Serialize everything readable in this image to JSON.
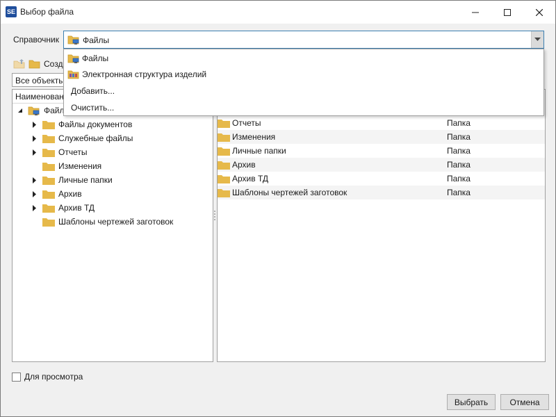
{
  "window": {
    "title": "Выбор файла",
    "app_icon_text": "SE"
  },
  "reference": {
    "label": "Справочник",
    "selected": "Файлы"
  },
  "toolbar": {
    "create_label": "Созда"
  },
  "filter": {
    "value": "Все объекты"
  },
  "tree": {
    "header": "Наименован",
    "root_label": "Файлы",
    "items": [
      {
        "label": "Файлы документов",
        "expandable": true
      },
      {
        "label": "Служебные файлы",
        "expandable": true
      },
      {
        "label": "Отчеты",
        "expandable": true
      },
      {
        "label": "Изменения",
        "expandable": false
      },
      {
        "label": "Личные папки",
        "expandable": true
      },
      {
        "label": "Архив",
        "expandable": true
      },
      {
        "label": "Архив ТД",
        "expandable": true
      },
      {
        "label": "Шаблоны чертежей заготовок",
        "expandable": false
      }
    ]
  },
  "list": {
    "rows": [
      {
        "name": "Отчеты",
        "type": "Папка"
      },
      {
        "name": "Изменения",
        "type": "Папка"
      },
      {
        "name": "Личные папки",
        "type": "Папка"
      },
      {
        "name": "Архив",
        "type": "Папка"
      },
      {
        "name": "Архив ТД",
        "type": "Папка"
      },
      {
        "name": "Шаблоны чертежей заготовок",
        "type": "Папка"
      }
    ]
  },
  "dropdown": {
    "items": [
      {
        "label": "Файлы",
        "icon": "folder-computer-icon"
      },
      {
        "label": "Электронная структура изделий",
        "icon": "product-structure-icon"
      },
      {
        "label": "Добавить...",
        "icon": ""
      },
      {
        "label": "Очистить...",
        "icon": ""
      }
    ]
  },
  "footer": {
    "preview_label": "Для просмотра",
    "preview_checked": false,
    "ok_label": "Выбрать",
    "cancel_label": "Отмена"
  },
  "colors": {
    "folder": "#e6b94a",
    "accent_border": "#3c7fb1",
    "app_icon_bg": "#1f4e9c"
  }
}
